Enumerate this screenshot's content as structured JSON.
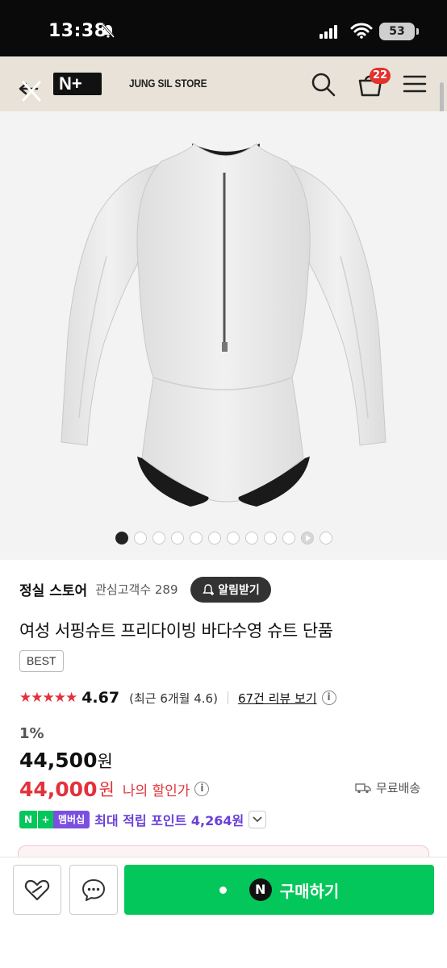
{
  "status": {
    "time": "13:38",
    "battery": "53"
  },
  "header": {
    "logo": "N+",
    "store_name": "JUNG SIL STORE",
    "cart_count": "22"
  },
  "gallery": {
    "total_slides": 11,
    "active_index": 0
  },
  "store": {
    "name": "정실 스토어",
    "followers_label": "관심고객수 289",
    "alarm_button": "알림받기"
  },
  "product": {
    "name": "여성 서핑슈트 프리다이빙 바다수영 슈트 단품",
    "badge": "BEST",
    "rating_value": "4.67",
    "rating_stars": 4.67,
    "recent_rating": "(최근 6개월 4.6)",
    "review_link": "67건 리뷰 보기"
  },
  "price": {
    "discount_rate": "1%",
    "original": "44,500",
    "currency": "원",
    "sale": "44,000",
    "my_discount_label": "나의 할인가",
    "shipping": "무료배송"
  },
  "membership": {
    "badge_n": "N",
    "badge_plus": "+",
    "badge_label": "멤버십",
    "points_text": "최대 적립 포인트 4,264원"
  },
  "bottom_bar": {
    "buy_label": "구매하기",
    "naver_n": "N"
  },
  "colors": {
    "accent_green": "#03c75a",
    "sale_red": "#e3313b",
    "membership_purple": "#6a3fd8"
  }
}
